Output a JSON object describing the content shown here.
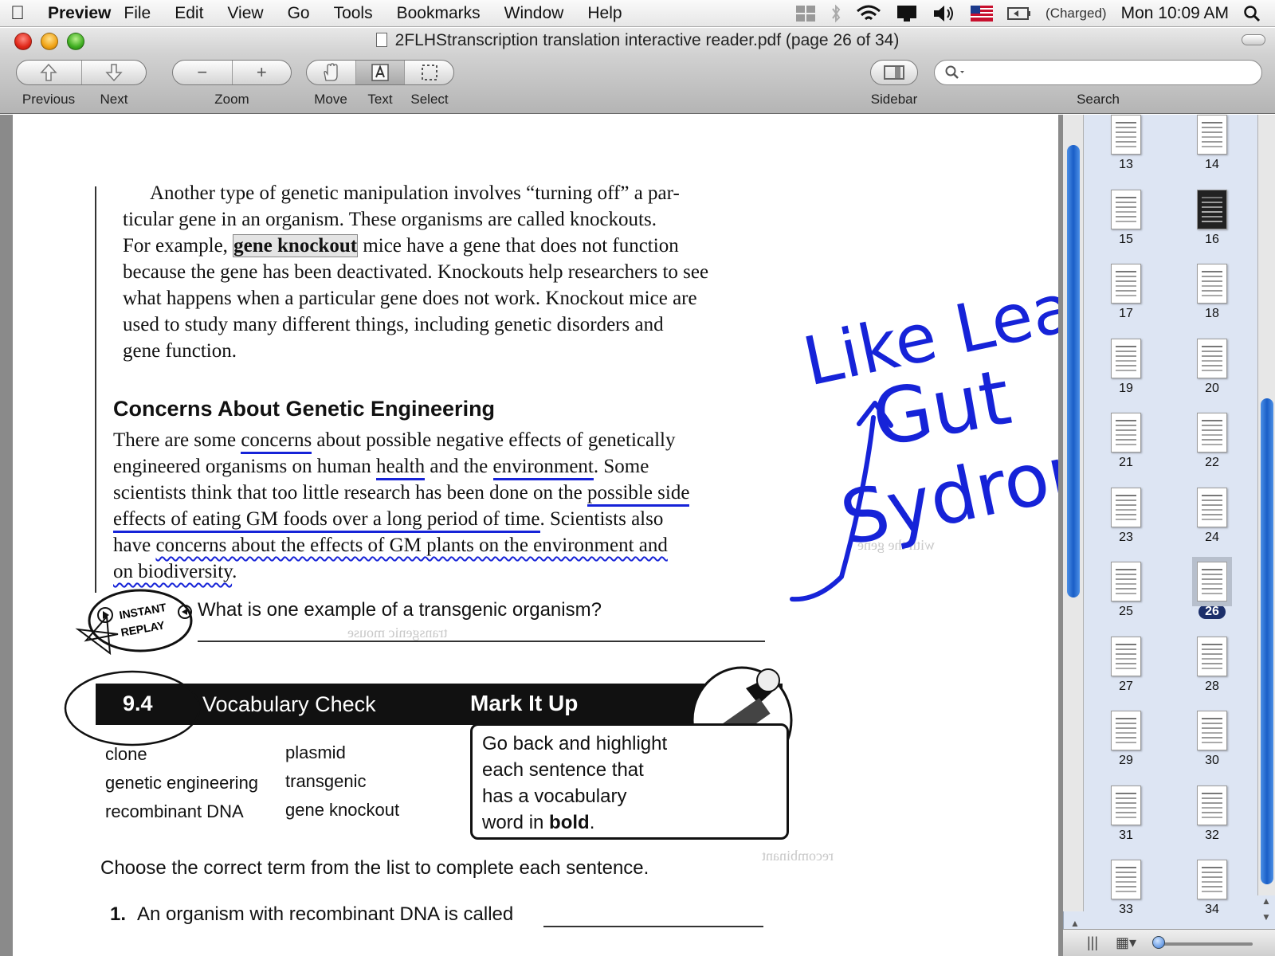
{
  "menubar": {
    "app_name": "Preview",
    "menus": [
      "File",
      "Edit",
      "View",
      "Go",
      "Tools",
      "Bookmarks",
      "Window",
      "Help"
    ],
    "status": {
      "battery": "(Charged)",
      "clock": "Mon 10:09 AM"
    }
  },
  "window": {
    "title": "2FLHStranscription translation interactive reader.pdf (page 26 of 34)"
  },
  "toolbar": {
    "previous_label": "Previous",
    "next_label": "Next",
    "zoom_label": "Zoom",
    "move_label": "Move",
    "text_label": "Text",
    "select_label": "Select",
    "sidebar_label": "Sidebar",
    "search_label": "Search",
    "search_placeholder": "",
    "active_tool": "Text"
  },
  "document": {
    "para1": [
      "Another type of genetic manipulation involves “turning off” a par-",
      "ticular gene in an organism. These organisms are called knockouts.",
      "mice have a gene that does not function",
      "because the gene has been deactivated. Knockouts help researchers to see",
      "what happens when a particular gene does not work. Knockout mice are",
      "used to study many different things, including genetic disorders and",
      "gene function."
    ],
    "para1_prefix": "For example, ",
    "para1_term": "gene knockout",
    "heading": "Concerns About Genetic Engineering",
    "para2": {
      "l1a": "There are some ",
      "l1u": "concerns",
      "l1b": " about possible negative effects of genetically",
      "l2a": "engineered organisms on human ",
      "l2u1": "health",
      "l2b": " and the ",
      "l2u2": "environment",
      "l2c": ". Some",
      "l3a": "scientists think that too little research has been done on the ",
      "l3u": "possible side",
      "l4u": "effects of eating GM foods over a long period of time",
      "l4b": ". Scientists also",
      "l5a": "have ",
      "l5w": "concerns about the effects of GM plants on the environment and",
      "l6w": "on biodiversity",
      "l6b": "."
    },
    "replay_stamp": "INSTANT REPLAY",
    "replay_question": "What is one example of a transgenic organism?",
    "vocab": {
      "number": "9.4",
      "title": "Vocabulary Check",
      "markup_title": "Mark It Up",
      "terms_col1": [
        "clone",
        "genetic engineering",
        "recombinant DNA"
      ],
      "terms_col2": [
        "plasmid",
        "transgenic",
        "gene knockout"
      ],
      "markup_text": [
        "Go back and highlight",
        "each sentence that",
        "has a vocabulary",
        "word in "
      ],
      "markup_bold": "bold",
      "markup_end": "."
    },
    "choose_instruction": "Choose the correct term from the list to complete each sentence.",
    "q1_number": "1.",
    "q1_text": "An organism with recombinant DNA is called",
    "handwriting": [
      "Like Leaky",
      "Gut",
      "Sydrome"
    ],
    "ink_color": "#1623d8"
  },
  "thumbnails": {
    "pages": [
      "13",
      "14",
      "15",
      "16",
      "17",
      "18",
      "19",
      "20",
      "21",
      "22",
      "23",
      "24",
      "25",
      "26",
      "27",
      "28",
      "29",
      "30",
      "31",
      "32",
      "33",
      "34"
    ],
    "current": "26"
  }
}
